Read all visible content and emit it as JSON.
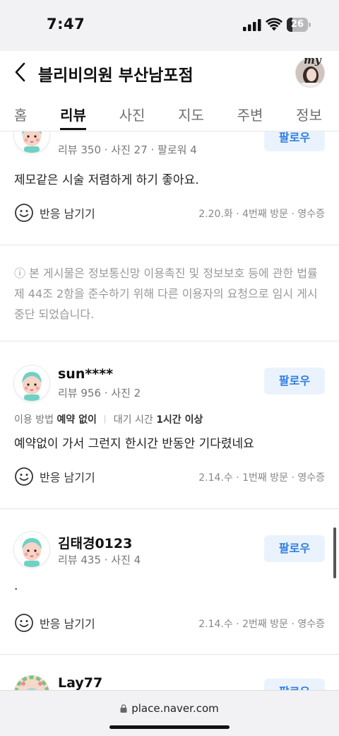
{
  "status_bar": {
    "time": "7:47",
    "battery": "26",
    "battery_level": 0.26
  },
  "header": {
    "title": "블리비의원 부산남포점",
    "profile_badge": "my"
  },
  "tabs": [
    {
      "label": "홈",
      "active": false
    },
    {
      "label": "리뷰",
      "active": true
    },
    {
      "label": "사진",
      "active": false
    },
    {
      "label": "지도",
      "active": false
    },
    {
      "label": "주변",
      "active": false
    },
    {
      "label": "정보",
      "active": false
    }
  ],
  "reviews": [
    {
      "name": "",
      "stats": "리뷰 350 · 사진 27 · 팔로워 4",
      "follow_label": "팔로우",
      "text": "제모같은 시술 저렴하게 하기 좋아요.",
      "reaction_label": "반응 남기기",
      "visit_info": "2.20.화 · 4번째 방문 · 영수증"
    },
    {
      "name": "sun****",
      "stats": "리뷰 956 · 사진 2",
      "follow_label": "팔로우",
      "meta": {
        "label1": "이용 방법",
        "value1": "예약 없이",
        "label2": "대기 시간",
        "value2": "1시간 이상"
      },
      "text": "예약없이 가서 그런지 한시간 반동안 기다렸네요",
      "reaction_label": "반응 남기기",
      "visit_info": "2.14.수 · 1번째 방문 · 영수증"
    },
    {
      "name": "김태경0123",
      "stats": "리뷰 435 · 사진 4",
      "follow_label": "팔로우",
      "text": ".",
      "reaction_label": "반응 남기기",
      "visit_info": "2.14.수 · 2번째 방문 · 영수증"
    },
    {
      "name": "Lay77",
      "follow_label": "팔로우"
    }
  ],
  "blocked_notice": "ⓘ 본 게시물은 정보통신망 이용촉진 및 정보보호 등에 관한 법률 제 44조 2항을 준수하기 위해 다른 이용자의 요청으로 임시 게시중단 되었습니다.",
  "url_bar": {
    "url": "place.naver.com"
  },
  "colors": {
    "follow_bg": "#eaf3fd",
    "follow_text": "#2f7ee0",
    "avatar_face": "#f7d4c6",
    "avatar_hair": "#6fd1c4"
  }
}
